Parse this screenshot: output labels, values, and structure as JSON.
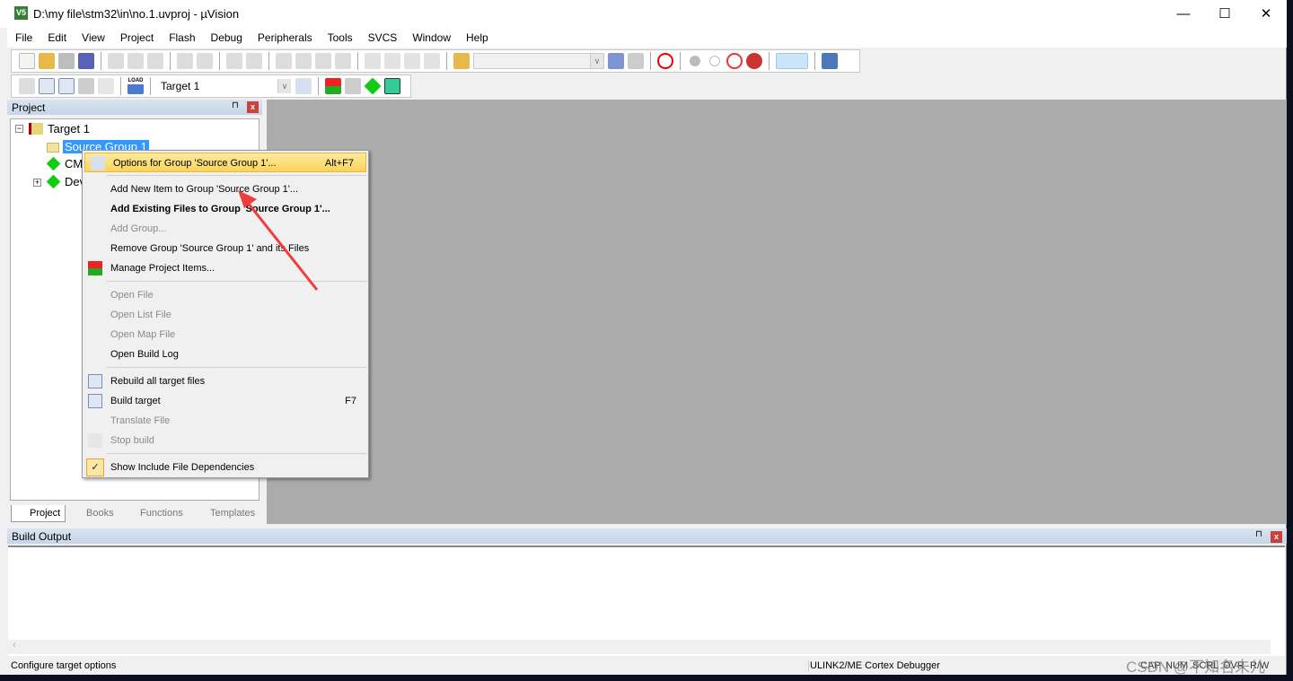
{
  "window": {
    "title": "D:\\my file\\stm32\\in\\no.1.uvproj - µVision",
    "app_icon": "V5",
    "minimize": "—",
    "maximize": "☐",
    "close": "✕"
  },
  "menubar": [
    "File",
    "Edit",
    "View",
    "Project",
    "Flash",
    "Debug",
    "Peripherals",
    "Tools",
    "SVCS",
    "Window",
    "Help"
  ],
  "toolbar2": {
    "target_select": "Target 1",
    "load_label": "LOAD"
  },
  "project_panel": {
    "title": "Project",
    "pin": "⊓",
    "close": "x",
    "tree": {
      "root": "Target 1",
      "items": [
        "Source Group 1",
        "CM",
        "Dev"
      ]
    },
    "tabs": [
      "Project",
      "Books",
      "Functions",
      "Templates"
    ]
  },
  "context_menu": [
    {
      "label": "Options for Group 'Source Group 1'...",
      "shortcut": "Alt+F7",
      "state": "highlighted"
    },
    {
      "label": "Add New  Item to Group 'Source Group 1'...",
      "state": "enabled"
    },
    {
      "label": "Add Existing Files to Group 'Source Group 1'...",
      "state": "bold"
    },
    {
      "label": "Add Group...",
      "state": "disabled"
    },
    {
      "label": "Remove Group 'Source Group 1' and its Files",
      "state": "enabled"
    },
    {
      "label": "Manage Project Items...",
      "state": "enabled"
    },
    {
      "label": "Open File",
      "state": "disabled"
    },
    {
      "label": "Open List File",
      "state": "disabled"
    },
    {
      "label": "Open Map File",
      "state": "disabled"
    },
    {
      "label": "Open Build Log",
      "state": "enabled"
    },
    {
      "label": "Rebuild all target files",
      "state": "enabled"
    },
    {
      "label": "Build target",
      "shortcut": "F7",
      "state": "enabled"
    },
    {
      "label": "Translate File",
      "state": "disabled"
    },
    {
      "label": "Stop build",
      "state": "disabled"
    },
    {
      "label": "Show Include File Dependencies",
      "state": "checked",
      "check": "✓"
    }
  ],
  "build_output": {
    "title": "Build Output"
  },
  "status": {
    "message": "Configure target options",
    "debugger": "ULINK2/ME Cortex Debugger",
    "indicators": [
      "CAP",
      "NUM",
      "SCRL",
      "OVR",
      "R/W"
    ]
  },
  "watermark": "CSDN @不知名未儿",
  "colors": {
    "highlight": "#f9d35b",
    "selection": "#3399ff",
    "editor_bg": "#ababab",
    "annotation_arrow": "#f03c3c"
  }
}
